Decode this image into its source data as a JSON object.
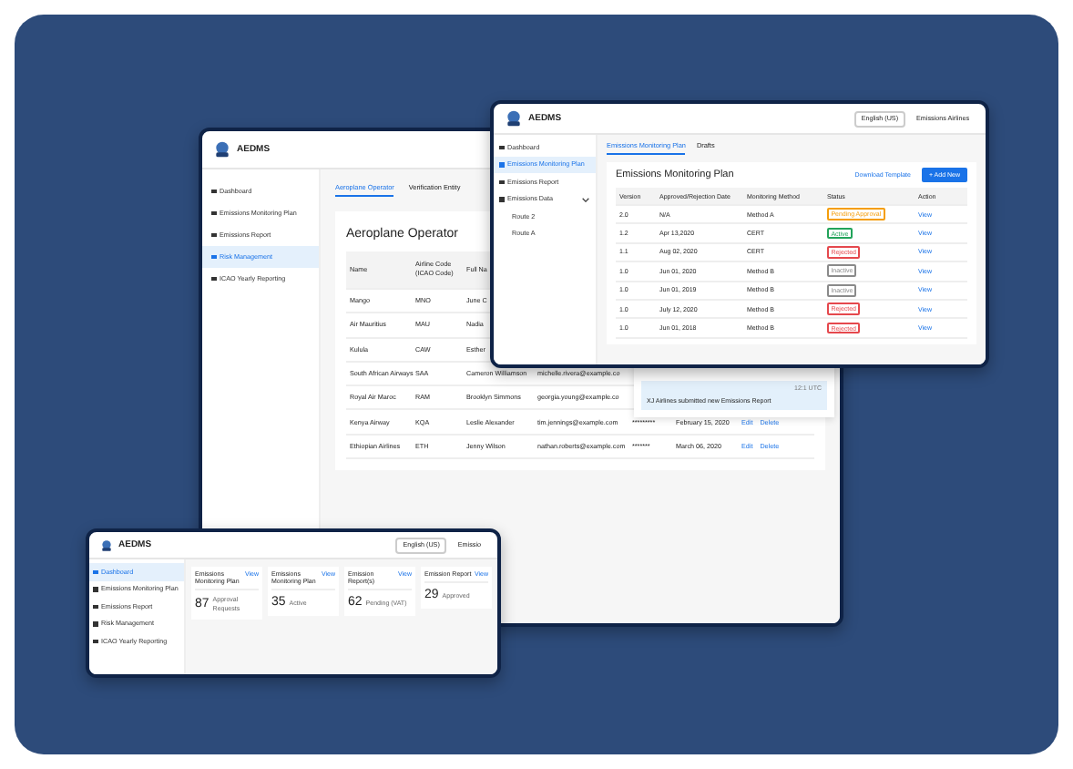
{
  "operator_window": {
    "app_name": "AEDMS",
    "sidebar": {
      "items": [
        {
          "label": "Dashboard",
          "selected": false
        },
        {
          "label": "Emissions Monitoring Plan",
          "selected": false
        },
        {
          "label": "Emissions Report",
          "selected": false
        },
        {
          "label": "Risk Management",
          "selected": true
        },
        {
          "label": "ICAO Yearly Reporting",
          "selected": false
        }
      ]
    },
    "tabs": [
      {
        "label": "Aeroplane Operator",
        "selected": true
      },
      {
        "label": "Verification Entity",
        "selected": false
      }
    ],
    "title": "Aeroplane Operator",
    "table": {
      "columns": [
        "Name",
        "Airline Code (ICAO Code)",
        "Full Na"
      ],
      "rows": [
        {
          "cells": [
            "Mango",
            "MNO",
            "June C"
          ]
        },
        {
          "cells": [
            "Air Mauritius",
            "MAU",
            "Nadia"
          ]
        },
        {
          "cells": [
            "Kulula",
            "CAW",
            "Esther"
          ]
        },
        {
          "cells": [
            "South African Airways",
            "SAA",
            "Cameron Williamson",
            "michelle.rivera@example.co"
          ]
        },
        {
          "cells": [
            "Royal Air Maroc",
            "RAM",
            "Brooklyn Simmons",
            "georgia.young@example.co"
          ]
        },
        {
          "cells": [
            "Kenya Airway",
            "KQA",
            "Leslie Alexander",
            "tim.jennings@example.com",
            "*********",
            "February 15, 2020"
          ],
          "actions": [
            "Edit",
            "Delete"
          ]
        },
        {
          "cells": [
            "Ethiopian Airlines",
            "ETH",
            "Jenny Wilson",
            "nathan.roberts@example.com",
            "*******",
            "March 06, 2020"
          ],
          "actions": [
            "Edit",
            "Delete"
          ]
        }
      ]
    },
    "notification": {
      "time": "12:1 UTC",
      "text": "XJ Airlines submitted new Emissions Report"
    }
  },
  "plan_window": {
    "app_name": "AEDMS",
    "language": "English (US)",
    "user": "Emissions Airlines",
    "sidebar": {
      "items": [
        {
          "label": "Dashboard",
          "selected": false
        },
        {
          "label": "Emissions Monitoring Plan",
          "selected": true
        },
        {
          "label": "Emissions Report",
          "selected": false
        },
        {
          "label": "Emissions Data",
          "selected": false,
          "expanded": true,
          "children": [
            {
              "label": "Route 2",
              "selected": false
            },
            {
              "label": "Route A",
              "selected": false
            }
          ]
        }
      ]
    },
    "tabs": [
      {
        "label": "Emissions Monitoring Plan",
        "selected": true
      },
      {
        "label": "Drafts",
        "selected": false
      }
    ],
    "title": "Emissions Monitoring Plan",
    "download_link": "Download Template",
    "add_button": "+ Add New",
    "table": {
      "columns": [
        "Version",
        "Approved/Rejection Date",
        "Monitoring Method",
        "Status",
        "Action"
      ],
      "rows": [
        {
          "version": "2.0",
          "date": "N/A",
          "method": "Method A",
          "status": "Pending Approval",
          "color": "#f59e0b",
          "action": "View"
        },
        {
          "version": "1.2",
          "date": "Apr 13,2020",
          "method": "CERT",
          "status": "Active",
          "color": "#22a35a",
          "action": "View"
        },
        {
          "version": "1.1",
          "date": "Aug 02, 2020",
          "method": "CERT",
          "status": "Rejected",
          "color": "#e5484d",
          "action": "View"
        },
        {
          "version": "1.0",
          "date": "Jun 01, 2020",
          "method": "Method B",
          "status": "Inactive",
          "color": "#8a8a8a",
          "action": "View"
        },
        {
          "version": "1.0",
          "date": "Jun 01, 2019",
          "method": "Method B",
          "status": "Inactive",
          "color": "#8a8a8a",
          "action": "View"
        },
        {
          "version": "1.0",
          "date": "July 12, 2020",
          "method": "Method B",
          "status": "Rejected",
          "color": "#e5484d",
          "action": "View"
        },
        {
          "version": "1.0",
          "date": "Jun 01, 2018",
          "method": "Method B",
          "status": "Rejected",
          "color": "#e5484d",
          "action": "View"
        }
      ]
    }
  },
  "dashboard_window": {
    "app_name": "AEDMS",
    "language": "English (US)",
    "user": "Emissio",
    "sidebar": {
      "items": [
        {
          "label": "Dashboard",
          "selected": true
        },
        {
          "label": "Emissions Monitoring Plan",
          "selected": false
        },
        {
          "label": "Emissions Report",
          "selected": false
        },
        {
          "label": "Risk Management",
          "selected": false
        },
        {
          "label": "ICAO Yearly Reporting",
          "selected": false
        }
      ]
    },
    "cards": [
      {
        "title": "Emissions Monitoring Plan",
        "link": "View",
        "count": "87",
        "caption": "Approval Requests"
      },
      {
        "title": "Emissions Monitoring Plan",
        "link": "View",
        "count": "35",
        "caption": "Active"
      },
      {
        "title": "Emission Report(s)",
        "link": "View",
        "count": "62",
        "caption": "Pending (VAT)"
      },
      {
        "title": "Emission Report",
        "link": "View",
        "count": "29",
        "caption": "Approved"
      }
    ]
  }
}
